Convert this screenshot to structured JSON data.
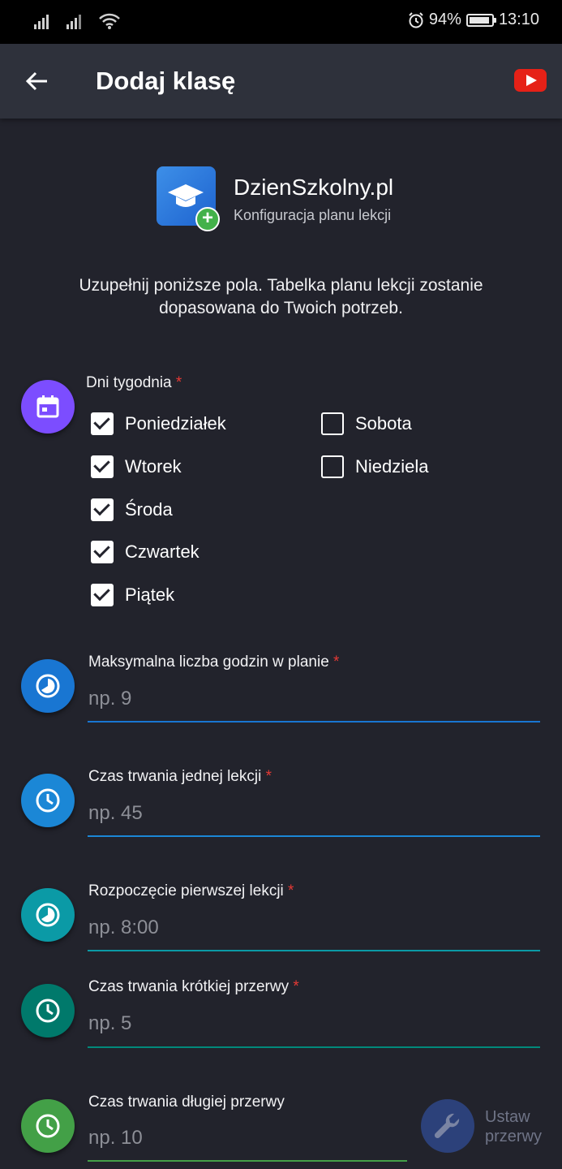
{
  "status_bar": {
    "battery": "94%",
    "time": "13:10",
    "battery_level": 0.94
  },
  "app_bar": {
    "title": "Dodaj klasę",
    "back_icon": "arrow-back-icon",
    "action_icon": "youtube-icon"
  },
  "header": {
    "app_name": "DzienSzkolny.pl",
    "subtitle": "Konfiguracja planu lekcji",
    "intro_line1": "Uzupełnij poniższe pola. Tabelka planu lekcji zostanie",
    "intro_line2": "dopasowana do Twoich potrzeb."
  },
  "days": {
    "label": "Dni tygodnia",
    "required_mark": "*",
    "items": [
      {
        "label": "Poniedziałek",
        "checked": true
      },
      {
        "label": "Wtorek",
        "checked": true
      },
      {
        "label": "Środa",
        "checked": true
      },
      {
        "label": "Czwartek",
        "checked": true
      },
      {
        "label": "Piątek",
        "checked": true
      },
      {
        "label": "Sobota",
        "checked": false
      },
      {
        "label": "Niedziela",
        "checked": false
      }
    ]
  },
  "fields": {
    "max_hours": {
      "label": "Maksymalna liczba godzin w planie",
      "required_mark": "*",
      "placeholder": "np. 9",
      "color": "#1976d2"
    },
    "lesson_length": {
      "label": "Czas trwania jednej lekcji",
      "required_mark": "*",
      "placeholder": "np. 45",
      "color": "#1b87d6"
    },
    "first_lesson": {
      "label": "Rozpoczęcie pierwszej lekcji",
      "required_mark": "*",
      "placeholder": "np. 8:00",
      "color": "#0b9aa6"
    },
    "short_break": {
      "label": "Czas trwania krótkiej przerwy",
      "required_mark": "*",
      "placeholder": "np. 5",
      "color": "#00897b"
    },
    "long_break": {
      "label": "Czas trwania długiej przerwy",
      "placeholder": "np. 10",
      "color": "#43a047"
    }
  },
  "fab": {
    "line1": "Ustaw",
    "line2": "przerwy",
    "icon": "wrench-icon"
  },
  "colors": {
    "calendar": "#7c4dff",
    "background": "#22232c",
    "appbar": "#2e313b"
  }
}
